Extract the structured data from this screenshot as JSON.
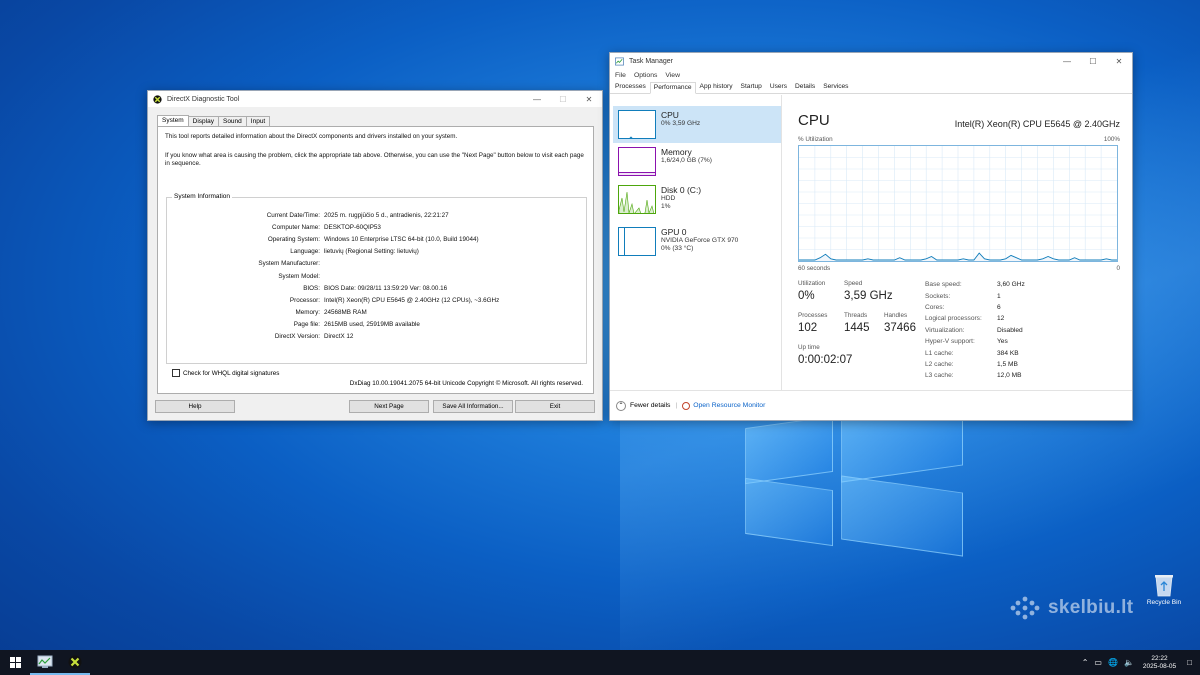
{
  "dxdiag": {
    "title": "DirectX Diagnostic Tool",
    "tabs": [
      "System",
      "Display",
      "Sound",
      "Input"
    ],
    "intro1": "This tool reports detailed information about the DirectX components and drivers installed on your system.",
    "intro2": "If you know what area is causing the problem, click the appropriate tab above.  Otherwise, you can use the \"Next Page\" button below to visit each page in sequence.",
    "section_title": "System Information",
    "rows": [
      {
        "k": "Current Date/Time:",
        "v": "2025 m. rugpjūčio 5 d., antradienis, 22:21:27"
      },
      {
        "k": "Computer Name:",
        "v": "DESKTOP-60QIP53"
      },
      {
        "k": "Operating System:",
        "v": "Windows 10 Enterprise LTSC 64-bit (10.0, Build 19044)"
      },
      {
        "k": "Language:",
        "v": "lietuvių (Regional Setting: lietuvių)"
      },
      {
        "k": "System Manufacturer:",
        "v": ""
      },
      {
        "k": "System Model:",
        "v": ""
      },
      {
        "k": "BIOS:",
        "v": "BIOS Date: 09/28/11 13:59:29 Ver: 08.00.16"
      },
      {
        "k": "Processor:",
        "v": "Intel(R) Xeon(R) CPU         E5645  @ 2.40GHz (12 CPUs), ~3.6GHz"
      },
      {
        "k": "Memory:",
        "v": "24568MB RAM"
      },
      {
        "k": "Page file:",
        "v": "2615MB used, 25919MB available"
      },
      {
        "k": "DirectX Version:",
        "v": "DirectX 12"
      }
    ],
    "whql": "Check for WHQL digital signatures",
    "copyright": "DxDiag 10.00.19041.2075 64-bit Unicode  Copyright © Microsoft. All rights reserved.",
    "buttons": {
      "help": "Help",
      "next": "Next Page",
      "save": "Save All Information...",
      "exit": "Exit"
    }
  },
  "taskmgr": {
    "title": "Task Manager",
    "menu": [
      "File",
      "Options",
      "View"
    ],
    "tabs": [
      "Processes",
      "Performance",
      "App history",
      "Startup",
      "Users",
      "Details",
      "Services"
    ],
    "items": [
      {
        "name": "CPU",
        "sub1": "0% 3,59 GHz",
        "sub2": "",
        "sub3": ""
      },
      {
        "name": "Memory",
        "sub1": "1,6/24,0 GB (7%)",
        "sub2": "",
        "sub3": ""
      },
      {
        "name": "Disk 0 (C:)",
        "sub1": "HDD",
        "sub2": "1%",
        "sub3": ""
      },
      {
        "name": "GPU 0",
        "sub1": "NVIDIA GeForce GTX 970",
        "sub2": "0% (33 °C)",
        "sub3": ""
      }
    ],
    "heading": "CPU",
    "model": "Intel(R) Xeon(R) CPU E5645 @ 2.40GHz",
    "graph_label_left": "% Utilization",
    "graph_label_right": "100%",
    "graph_bottom_left": "60 seconds",
    "graph_bottom_right": "0",
    "utilization_series": [
      0,
      0,
      0,
      0,
      2,
      5,
      1,
      0,
      0,
      0,
      0,
      0,
      0,
      1,
      0,
      0,
      0,
      0,
      0,
      2,
      0,
      0,
      0,
      0,
      1,
      3,
      0,
      0,
      0,
      0,
      0,
      1,
      0,
      0,
      6,
      1,
      0,
      0,
      0,
      1,
      4,
      2,
      0,
      0,
      0,
      0,
      1,
      3,
      1,
      0,
      0,
      0,
      2,
      0,
      0,
      0,
      0,
      0,
      1,
      0,
      0
    ],
    "stats": {
      "utilization_l": "Utilization",
      "utilization_v": "0%",
      "speed_l": "Speed",
      "speed_v": "3,59 GHz",
      "processes_l": "Processes",
      "processes_v": "102",
      "threads_l": "Threads",
      "threads_v": "1445",
      "handles_l": "Handles",
      "handles_v": "37466",
      "uptime_l": "Up time",
      "uptime_v": "0:00:02:07"
    },
    "spec": [
      {
        "k": "Base speed:",
        "v": "3,60 GHz"
      },
      {
        "k": "Sockets:",
        "v": "1"
      },
      {
        "k": "Cores:",
        "v": "6"
      },
      {
        "k": "Logical processors:",
        "v": "12"
      },
      {
        "k": "Virtualization:",
        "v": "Disabled"
      },
      {
        "k": "Hyper-V support:",
        "v": "Yes"
      },
      {
        "k": "L1 cache:",
        "v": "384 KB"
      },
      {
        "k": "L2 cache:",
        "v": "1,5 MB"
      },
      {
        "k": "L3 cache:",
        "v": "12,0 MB"
      }
    ],
    "fewer": "Fewer details",
    "resmon": "Open Resource Monitor"
  },
  "desktop": {
    "recycle_bin": "Recycle Bin",
    "watermark": "skelbiu.lt"
  },
  "taskbar": {
    "time": "22:22",
    "date": "2025-08-05"
  },
  "colors": {
    "cpu": "#117dbb",
    "memory": "#8b12ae",
    "disk": "#4da60c",
    "gpu": "#117dbb"
  }
}
